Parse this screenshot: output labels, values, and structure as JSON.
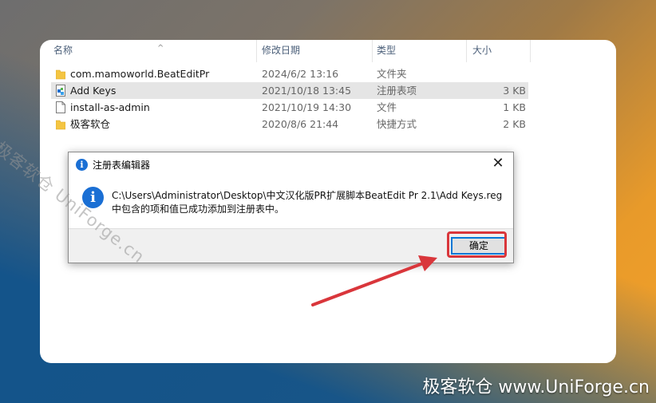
{
  "explorer": {
    "columns": [
      "名称",
      "修改日期",
      "类型",
      "大小"
    ],
    "files": [
      {
        "name": "com.mamoworld.BeatEditPr",
        "date": "2024/6/2 13:16",
        "type": "文件夹",
        "size": "",
        "icon": "folder-icon"
      },
      {
        "name": "Add Keys",
        "date": "2021/10/18 13:45",
        "type": "注册表项",
        "size": "3 KB",
        "icon": "registry-file-icon"
      },
      {
        "name": "install-as-admin",
        "date": "2021/10/19 14:30",
        "type": "文件",
        "size": "1 KB",
        "icon": "file-icon"
      },
      {
        "name": "极客软仓",
        "date": "2020/8/6 21:44",
        "type": "快捷方式",
        "size": "2 KB",
        "icon": "folder-shortcut-icon"
      }
    ]
  },
  "dialog": {
    "title": "注册表编辑器",
    "message_line1": "C:\\Users\\Administrator\\Desktop\\中文汉化版PR扩展脚本BeatEdit Pr 2.1\\Add Keys.reg",
    "message_line2": "中包含的项和值已成功添加到注册表中。",
    "ok_label": "确定",
    "info_glyph": "i",
    "close_glyph": "✕"
  },
  "annotation": {
    "highlight_color": "#d9363b"
  },
  "watermark": {
    "diagonal": "极客软仓 UniForge.cn",
    "bottom": "极客软仓 www.UniForge.cn"
  }
}
